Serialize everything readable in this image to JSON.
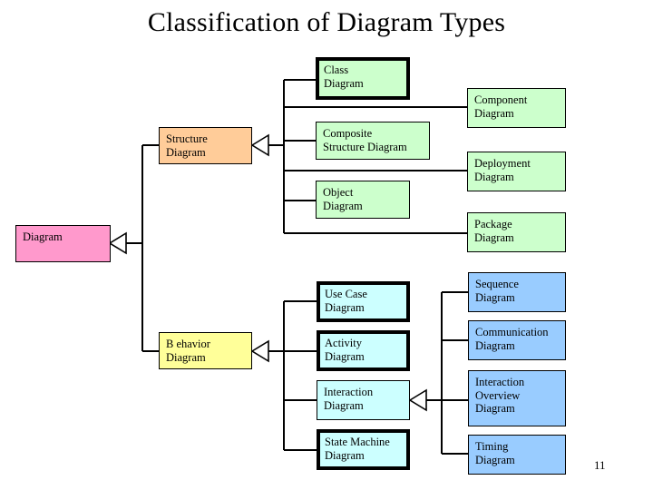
{
  "slide": {
    "title": "Classification of Diagram Types",
    "page_number": "11"
  },
  "colors": {
    "root": "#ff99cc",
    "structure": "#ffcc99",
    "behavior": "#ffff99",
    "structure_child": "#ccffcc",
    "behavior_child": "#ccffff",
    "interaction_child": "#99ccff",
    "border": "#000000",
    "background": "#ffffff"
  },
  "nodes": {
    "diagram": {
      "line1": "Diagram",
      "line2": "",
      "line3": ""
    },
    "structure_diagram": {
      "line1": "Structure",
      "line2": "Diagram",
      "line3": ""
    },
    "behavior_diagram": {
      "line1": "B ehavior",
      "line2": "Diagram",
      "line3": ""
    },
    "class_diagram": {
      "line1": "Class",
      "line2": "Diagram",
      "line3": ""
    },
    "composite_structure_diagram": {
      "line1": "Composite",
      "line2": "Structure Diagram",
      "line3": ""
    },
    "object_diagram": {
      "line1": "Object",
      "line2": "Diagram",
      "line3": ""
    },
    "component_diagram": {
      "line1": "Component",
      "line2": "Diagram",
      "line3": ""
    },
    "deployment_diagram": {
      "line1": "Deployment",
      "line2": "Diagram",
      "line3": ""
    },
    "package_diagram": {
      "line1": "Package",
      "line2": "Diagram",
      "line3": ""
    },
    "use_case_diagram": {
      "line1": "Use Case",
      "line2": "Diagram",
      "line3": ""
    },
    "activity_diagram": {
      "line1": "Activity",
      "line2": "Diagram",
      "line3": ""
    },
    "interaction_diagram": {
      "line1": "Interaction",
      "line2": "Diagram",
      "line3": ""
    },
    "state_machine_diagram": {
      "line1": "State Machine",
      "line2": "Diagram",
      "line3": ""
    },
    "sequence_diagram": {
      "line1": "Sequence",
      "line2": "Diagram",
      "line3": ""
    },
    "communication_diagram": {
      "line1": "Communication",
      "line2": "Diagram",
      "line3": ""
    },
    "interaction_overview_diagram": {
      "line1": "Interaction",
      "line2": "Overview",
      "line3": "Diagram"
    },
    "timing_diagram": {
      "line1": "Timing",
      "line2": "Diagram",
      "line3": ""
    }
  },
  "chart_data": {
    "type": "diagram",
    "title": "Classification of Diagram Types",
    "notation": "UML generalization hierarchy (hollow triangle arrowheads point to the parent)",
    "root": "Diagram",
    "hierarchy": [
      {
        "name": "Structure Diagram",
        "color": "#ffcc99",
        "children": [
          {
            "name": "Class Diagram",
            "color": "#ccffcc",
            "emphasis": "thick-border"
          },
          {
            "name": "Component Diagram",
            "color": "#ccffcc",
            "emphasis": "none"
          },
          {
            "name": "Composite Structure Diagram",
            "color": "#ccffcc",
            "emphasis": "none"
          },
          {
            "name": "Deployment Diagram",
            "color": "#ccffcc",
            "emphasis": "none"
          },
          {
            "name": "Object Diagram",
            "color": "#ccffcc",
            "emphasis": "none"
          },
          {
            "name": "Package Diagram",
            "color": "#ccffcc",
            "emphasis": "none"
          }
        ]
      },
      {
        "name": "Behavior Diagram",
        "color": "#ffff99",
        "children": [
          {
            "name": "Use Case Diagram",
            "color": "#ccffff",
            "emphasis": "thick-border"
          },
          {
            "name": "Activity Diagram",
            "color": "#ccffff",
            "emphasis": "thick-border"
          },
          {
            "name": "Interaction Diagram",
            "color": "#ccffff",
            "emphasis": "none",
            "children": [
              {
                "name": "Sequence Diagram",
                "color": "#99ccff",
                "emphasis": "none"
              },
              {
                "name": "Communication Diagram",
                "color": "#99ccff",
                "emphasis": "none"
              },
              {
                "name": "Interaction Overview Diagram",
                "color": "#99ccff",
                "emphasis": "none"
              },
              {
                "name": "Timing Diagram",
                "color": "#99ccff",
                "emphasis": "none"
              }
            ]
          },
          {
            "name": "State Machine Diagram",
            "color": "#ccffff",
            "emphasis": "thick-border"
          }
        ]
      }
    ]
  }
}
